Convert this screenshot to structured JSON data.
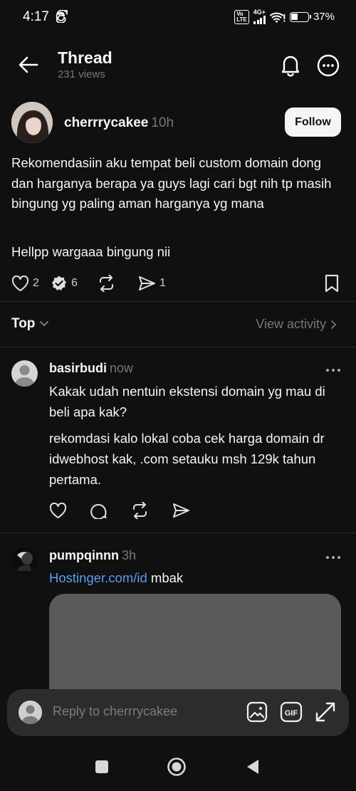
{
  "status": {
    "time": "4:17",
    "network": "4G+",
    "volte_top": "Vo",
    "volte_bottom": "LTE",
    "battery": "37%",
    "battery_level": 0.37,
    "threads_icon": "threads-icon"
  },
  "header": {
    "title": "Thread",
    "views": "231 views"
  },
  "post": {
    "username": "cherrrycakee",
    "time": "10h",
    "follow_label": "Follow",
    "text": "Rekomendasiin aku tempat beli custom domain dong dan harganya berapa ya guys lagi cari bgt nih tp masih bingung yg paling aman harganya yg mana",
    "text2": "Hellpp wargaaa bingung nii",
    "likes": "2",
    "replies": "6",
    "shares": "1"
  },
  "sort": {
    "label": "Top",
    "view_activity": "View activity"
  },
  "replies": [
    {
      "username": "basirbudi",
      "time": "now",
      "text": "Kakak udah nentuin ekstensi domain yg mau di beli apa kak?",
      "text2": "rekomdasi kalo lokal coba cek harga domain dr idwebhost kak, .com setauku msh  129k tahun pertama."
    },
    {
      "username": "pumpqinnn",
      "time": "3h",
      "link": "Hostinger.com/id",
      "text_after_link": " mbak"
    }
  ],
  "composer": {
    "placeholder": "Reply to cherrrycakee"
  },
  "colors": {
    "background": "#101010",
    "link": "#5b9cf2",
    "muted": "#777777",
    "composer": "#2c2c2c"
  }
}
